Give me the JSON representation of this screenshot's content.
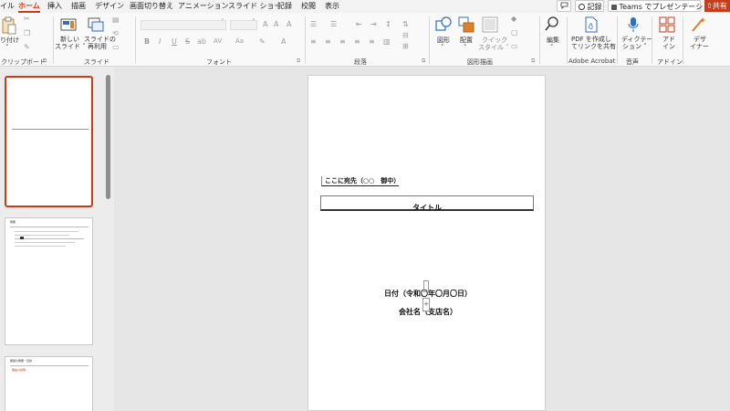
{
  "tabs": [
    {
      "label": "イル",
      "active": false
    },
    {
      "label": "ホーム",
      "active": true
    },
    {
      "label": "挿入",
      "active": false
    },
    {
      "label": "描画",
      "active": false
    },
    {
      "label": "デザイン",
      "active": false
    },
    {
      "label": "画面切り替え",
      "active": false
    },
    {
      "label": "アニメーション",
      "active": false
    },
    {
      "label": "スライド ショー",
      "active": false
    },
    {
      "label": "記録",
      "active": false
    },
    {
      "label": "校閲",
      "active": false
    },
    {
      "label": "表示",
      "active": false
    }
  ],
  "top_right": {
    "record_label": "記録",
    "teams_label": "Teams でプレゼンテーション",
    "share_label": "共有"
  },
  "ribbon": {
    "clipboard": {
      "paste_label_1": "り付け",
      "group": "クリップボード"
    },
    "slides": {
      "new_slide_1": "新しい",
      "new_slide_2": "スライド ˅",
      "reuse_1": "スライドの",
      "reuse_2": "再利用",
      "group": "スライド"
    },
    "font": {
      "group": "フォント",
      "bold": "B",
      "italic": "I",
      "underline": "U",
      "strike": "S",
      "shadow": "ab",
      "spacing": "AV",
      "aa": "Aa"
    },
    "paragraph": {
      "group": "段落"
    },
    "drawing": {
      "shapes": "図形",
      "arrange": "配置",
      "quick_1": "クイック",
      "quick_2": "スタイル ˅",
      "group": "図形描画"
    },
    "editing": {
      "label": "編集"
    },
    "adobe": {
      "label_1": "PDF を作成し",
      "label_2": "てリンクを共有",
      "group": "Adobe Acrobat"
    },
    "voice": {
      "label_1": "ディクテー",
      "label_2": "ション ˅",
      "group": "音声"
    },
    "addins": {
      "label_1": "アド",
      "label_2": "イン",
      "group": "アドイン"
    },
    "designer": {
      "label_1": "デザ",
      "label_2": "イナー"
    }
  },
  "slide": {
    "address": "ここに宛先（○○　御中）",
    "title": "タイトル",
    "date": "日付（令和〇年〇月〇日）",
    "company": "会社名（支店名）"
  },
  "thumbs": {
    "t2_title": "概要",
    "t3_title": "履歴の概要・目的",
    "t3_red": "理由の説明"
  },
  "colors": {
    "accent": "#c43e1c",
    "icon_blue": "#2f6fbf",
    "icon_orange": "#d9822b"
  }
}
